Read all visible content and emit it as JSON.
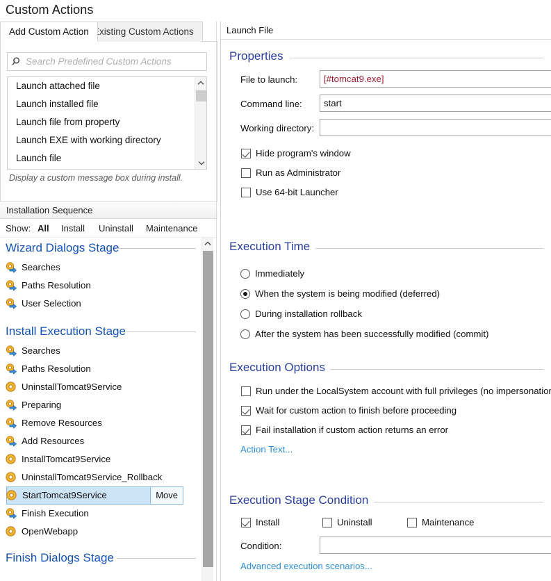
{
  "page": {
    "title": "Custom Actions"
  },
  "left": {
    "tabs": [
      {
        "label": "Add Custom Action",
        "active": true
      },
      {
        "label": "Existing Custom Actions",
        "active": false
      }
    ],
    "search": {
      "placeholder": "Search Predefined Custom Actions",
      "value": "",
      "icon": "search-icon"
    },
    "predefined_actions": [
      "Launch attached file",
      "Launch installed file",
      "Launch file from property",
      "Launch EXE with working directory",
      "Launch file"
    ],
    "hint": "Display a custom message box during install.",
    "sequence": {
      "header": "Installation Sequence",
      "show_label": "Show:",
      "filters": [
        {
          "label": "All",
          "selected": true
        },
        {
          "label": "Install",
          "selected": false
        },
        {
          "label": "Uninstall",
          "selected": false
        },
        {
          "label": "Maintenance",
          "selected": false
        }
      ],
      "stages": [
        {
          "name": "Wizard Dialogs Stage",
          "items": [
            {
              "label": "Searches",
              "icon": "standard-action-icon"
            },
            {
              "label": "Paths Resolution",
              "icon": "standard-action-icon"
            },
            {
              "label": "User Selection",
              "icon": "standard-action-icon"
            }
          ]
        },
        {
          "name": "Install Execution Stage",
          "items": [
            {
              "label": "Searches",
              "icon": "standard-action-icon"
            },
            {
              "label": "Paths Resolution",
              "icon": "standard-action-icon"
            },
            {
              "label": "UninstallTomcat9Service",
              "icon": "custom-action-icon"
            },
            {
              "label": "Preparing",
              "icon": "standard-action-icon"
            },
            {
              "label": "Remove Resources",
              "icon": "standard-action-icon"
            },
            {
              "label": "Add Resources",
              "icon": "standard-action-icon"
            },
            {
              "label": "InstallTomcat9Service",
              "icon": "custom-action-icon"
            },
            {
              "label": "UninstallTomcat9Service_Rollback",
              "icon": "custom-action-icon"
            },
            {
              "label": "StartTomcat9Service",
              "icon": "custom-action-icon",
              "selected": true,
              "move_label": "Move"
            },
            {
              "label": "Finish Execution",
              "icon": "standard-action-icon"
            },
            {
              "label": "OpenWebapp",
              "icon": "custom-action-icon"
            }
          ]
        },
        {
          "name": "Finish Dialogs Stage",
          "items": []
        }
      ]
    }
  },
  "right": {
    "header": "Launch File",
    "properties": {
      "title": "Properties",
      "file_to_launch_label": "File to launch:",
      "file_to_launch_value": "[#tomcat9.exe]",
      "command_line_label": "Command line:",
      "command_line_value": "start",
      "working_directory_label": "Working directory:",
      "working_directory_value": "",
      "checkboxes": [
        {
          "label": "Hide program's window",
          "checked": true
        },
        {
          "label": "Run as Administrator",
          "checked": false
        },
        {
          "label": "Use 64-bit Launcher",
          "checked": false
        }
      ]
    },
    "execution_time": {
      "title": "Execution Time",
      "options": [
        {
          "label": "Immediately",
          "selected": false
        },
        {
          "label": "When the system is being modified (deferred)",
          "selected": true
        },
        {
          "label": "During installation rollback",
          "selected": false
        },
        {
          "label": "After the system has been successfully modified (commit)",
          "selected": false
        }
      ]
    },
    "execution_options": {
      "title": "Execution Options",
      "checkboxes": [
        {
          "label": "Run under the LocalSystem account with full privileges (no impersonation)",
          "checked": false
        },
        {
          "label": "Wait for custom action to finish before proceeding",
          "checked": true
        },
        {
          "label": "Fail installation if custom action returns an error",
          "checked": true
        }
      ],
      "action_text_link": "Action Text..."
    },
    "execution_stage_condition": {
      "title": "Execution Stage Condition",
      "checkboxes": [
        {
          "label": "Install",
          "checked": true
        },
        {
          "label": "Uninstall",
          "checked": false
        },
        {
          "label": "Maintenance",
          "checked": false
        }
      ],
      "condition_label": "Condition:",
      "condition_value": "",
      "advanced_link": "Advanced execution scenarios..."
    }
  },
  "colors": {
    "stage_heading": "#1452b8",
    "group_heading": "#2b3f9e",
    "link": "#2e8fd8",
    "selection": "#cde4f7",
    "red_value": "#9c1b2e"
  }
}
